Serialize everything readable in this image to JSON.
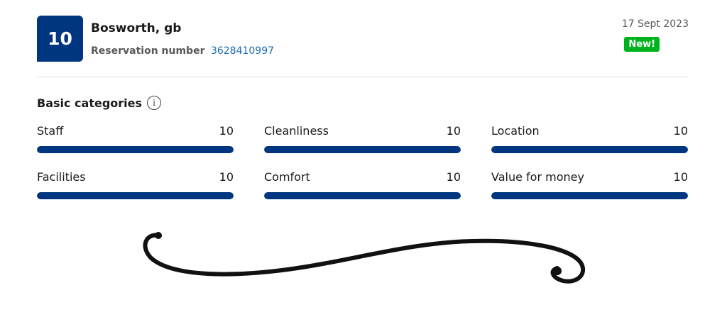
{
  "review": {
    "score": "10",
    "reviewer": "Bosworth, gb",
    "reservation_label": "Reservation number",
    "reservation_number": "3628410997",
    "date": "17 Sept 2023",
    "badge": "New!"
  },
  "section": {
    "title": "Basic categories",
    "info_icon": "info-icon"
  },
  "categories": [
    {
      "label": "Staff",
      "score": "10",
      "fraction": 1.0
    },
    {
      "label": "Cleanliness",
      "score": "10",
      "fraction": 1.0
    },
    {
      "label": "Location",
      "score": "10",
      "fraction": 1.0
    },
    {
      "label": "Facilities",
      "score": "10",
      "fraction": 1.0
    },
    {
      "label": "Comfort",
      "score": "10",
      "fraction": 1.0
    },
    {
      "label": "Value for money",
      "score": "10",
      "fraction": 1.0
    }
  ],
  "colors": {
    "brand": "#003580",
    "badge": "#00b31e",
    "link": "#1a6ab1"
  }
}
